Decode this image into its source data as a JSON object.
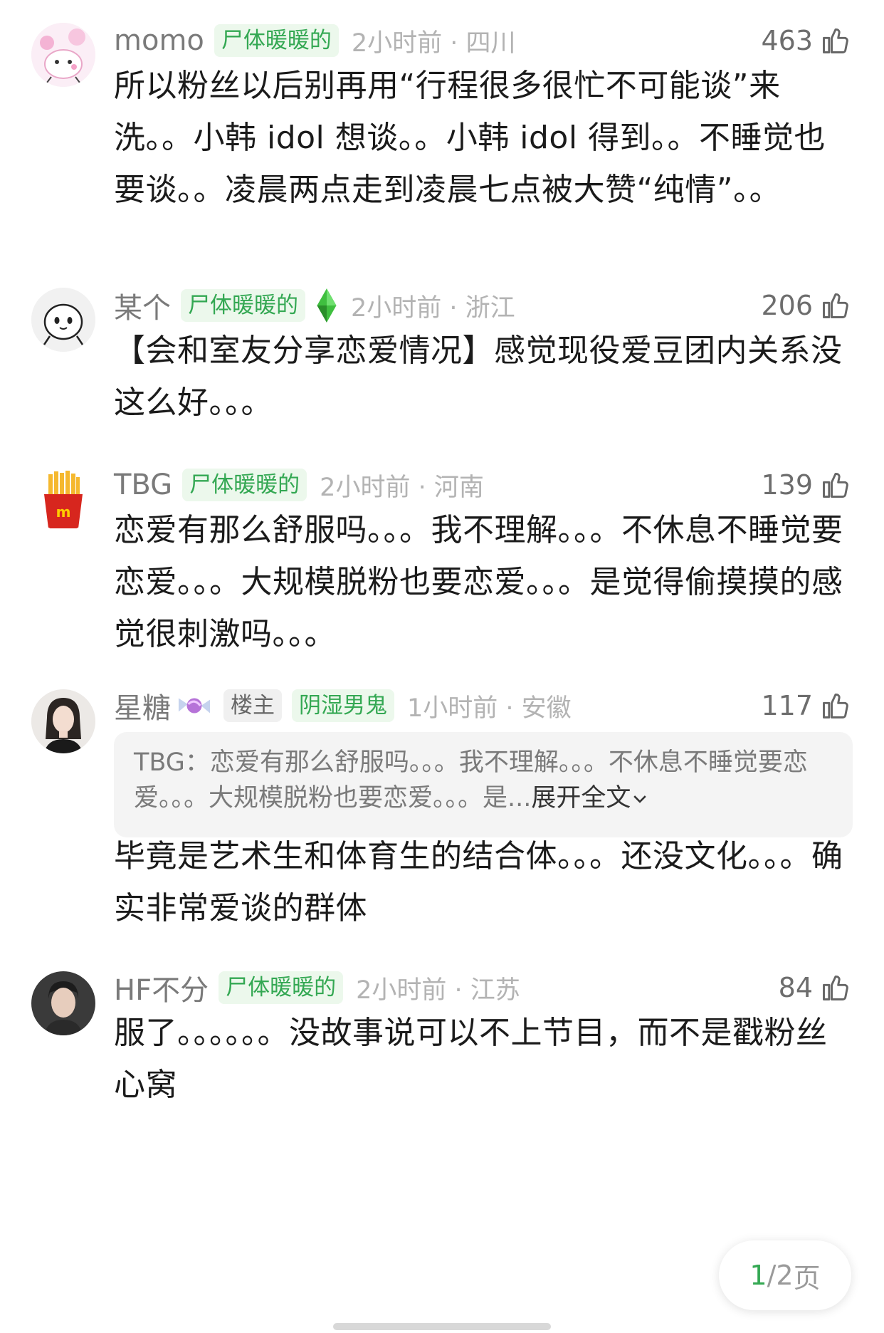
{
  "comments": [
    {
      "username": "momo",
      "tags": [
        "尸体暖暖的"
      ],
      "time_location": "2小时前 · 四川",
      "likes": "463",
      "text": "所以粉丝以后别再用“行程很多很忙不可能谈”来洗。。小韩 idol 想谈。。小韩 idol 得到。。不睡觉也要谈。。凌晨两点走到凌晨七点被大赞“纯情”。。",
      "avatar": "pink-cartoon-avatar"
    },
    {
      "username": "某个",
      "tags": [
        "尸体暖暖的"
      ],
      "badge_icon": "green-diamond-icon",
      "time_location": "2小时前 · 浙江",
      "likes": "206",
      "text": "【会和室友分享恋爱情况】感觉现役爱豆团内关系没这么好。。。",
      "avatar": "cartoon-face-avatar"
    },
    {
      "username": "TBG",
      "tags": [
        "尸体暖暖的"
      ],
      "time_location": "2小时前 · 河南",
      "likes": "139",
      "text": "恋爱有那么舒服吗。。。我不理解。。。不休息不睡觉要恋爱。。。大规模脱粉也要恋爱。。。是觉得偷摸摸的感觉很刺激吗。。。",
      "avatar": "fries-avatar"
    },
    {
      "username": "星糖",
      "username_icon": "candy-icon",
      "tags": [
        "楼主",
        "阴湿男鬼"
      ],
      "time_location": "1小时前 · 安徽",
      "likes": "117",
      "quote_author": "TBG：",
      "quote_text": "恋爱有那么舒服吗。。。我不理解。。。不休息不睡觉要恋爱。。。大规模脱粉也要恋爱。。。是...",
      "quote_expand": "展开全文",
      "text": "毕竟是艺术生和体育生的结合体。。。还没文化。。。确实非常爱谈的群体",
      "avatar": "woman-photo-avatar"
    },
    {
      "username": "HF不分",
      "tags": [
        "尸体暖暖的"
      ],
      "time_location": "2小时前 · 江苏",
      "likes": "84",
      "text": "服了。。。。。。没故事说可以不上节目，而不是戳粉丝心窝",
      "avatar": "man-photo-avatar"
    }
  ],
  "pager": {
    "current": "1",
    "total": "/2",
    "suffix": " 页"
  },
  "colors": {
    "tag_green": "#34a853",
    "tag_bg": "#ecf8ec",
    "meta_gray": "#b3b3b3"
  }
}
